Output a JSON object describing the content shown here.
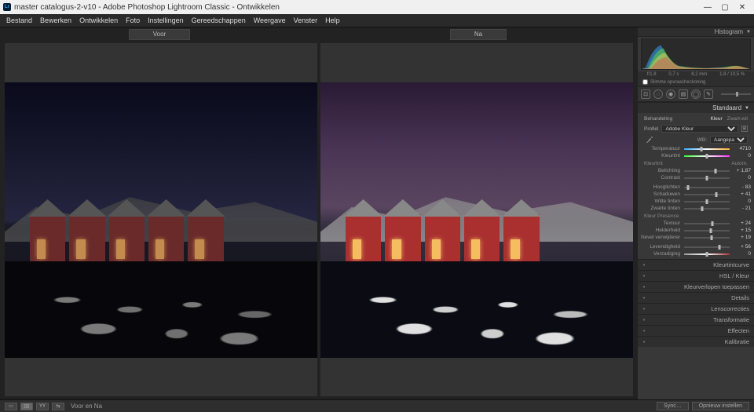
{
  "titlebar": {
    "title": "master catalogus-2-v10 - Adobe Photoshop Lightroom Classic - Ontwikkelen"
  },
  "menu": {
    "items": [
      "Bestand",
      "Bewerken",
      "Ontwikkelen",
      "Foto",
      "Instellingen",
      "Gereedschappen",
      "Weergave",
      "Venster",
      "Help"
    ]
  },
  "compare": {
    "before": "Voor",
    "after": "Na"
  },
  "histogram": {
    "title": "Histogram",
    "stats": [
      "",
      "f/1,8",
      "0,7 s",
      "",
      "8,2 mm",
      "1,8 / 10,5 %"
    ],
    "originalLabel": "Slimme opvraacheckoning"
  },
  "basic": {
    "title": "Standaard",
    "treatmentLabel": "Behandeling",
    "treatmentColor": "Kleur",
    "treatmentBW": "Zwart-wit",
    "profileLabel": "Profiel",
    "profileValue": "Adobe Kleur",
    "wbLabel": "WB:",
    "wbValue": "Aangepast",
    "tempLabel": "Temperatuur",
    "tempValue": "4710",
    "tintLabel": "Kleurtint",
    "tintValue": "0",
    "toneHeader": "Kleurtint",
    "toneAuto": "Autom.",
    "exposureLabel": "Belichting",
    "exposureValue": "+ 1,87",
    "contrastLabel": "Contrast",
    "contrastValue": "0",
    "highlightsLabel": "Hooglichten",
    "highlightsValue": "- 83",
    "shadowsLabel": "Schaduwen",
    "shadowsValue": "+ 41",
    "whitesLabel": "Witte tinten",
    "whitesValue": "0",
    "blacksLabel": "Zwarte tinten",
    "blacksValue": "- 21",
    "presenceHeader": "Kleur Presence",
    "textureLabel": "Textuur",
    "textureValue": "+ 24",
    "clarityLabel": "Helderheid",
    "clarityValue": "+ 15",
    "dehazeLabel": "Nevel verwijderen",
    "dehazeValue": "+ 19",
    "vibranceLabel": "Levendigheid",
    "vibranceValue": "+ 56",
    "saturationLabel": "Verzadiging",
    "saturationValue": "0"
  },
  "panels": {
    "tonecurve": "Kleurtintcurve",
    "hsl": "HSL / Kleur",
    "colorgrading": "Kleurverlopen toepassen",
    "detail": "Details",
    "lens": "Lenscorrecties",
    "transform": "Transformatie",
    "effects": "Effecten",
    "calibration": "Kalibratie"
  },
  "bottom": {
    "viewLabel": "Voor en Na",
    "sync": "Sync…",
    "reset": "Opnieuw instellen"
  }
}
